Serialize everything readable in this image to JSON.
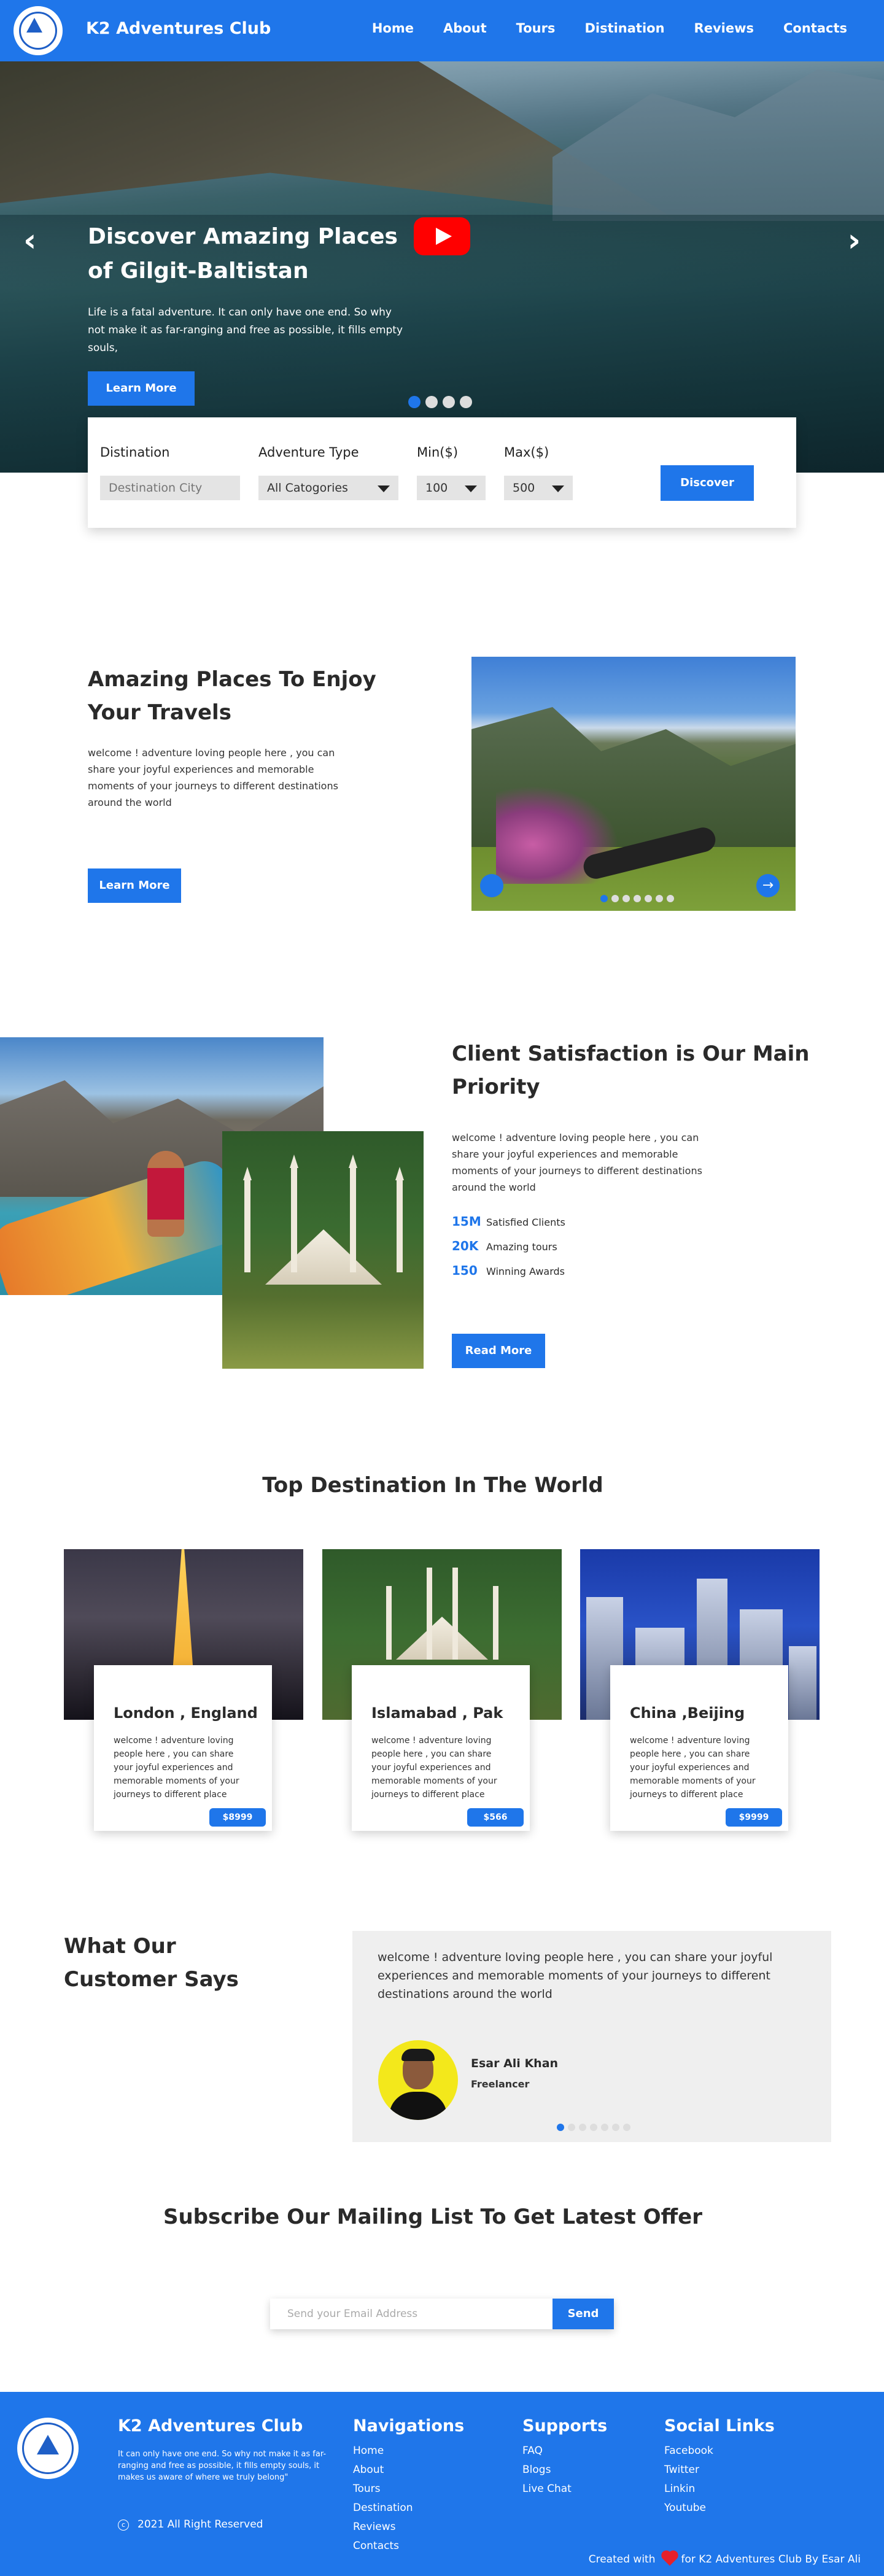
{
  "nav": {
    "brand": "K2 Adventures Club",
    "links": [
      "Home",
      "About",
      "Tours",
      "Distination",
      "Reviews",
      "Contacts"
    ]
  },
  "hero": {
    "title": "Discover Amazing Places of Gilgit-Baltistan",
    "text": "Life is a fatal adventure. It can only have one end. So why not make it as far-ranging and free as possible, it fills empty souls,",
    "button": "Learn More",
    "prev_icon": "chevron-left-icon",
    "next_icon": "chevron-right-icon",
    "slide_count": 4,
    "active_slide": 1
  },
  "search": {
    "destination_label": "Distination",
    "destination_placeholder": "Destination City",
    "type_label": "Adventure Type",
    "type_value": "All Catogories",
    "min_label": "Min($)",
    "min_value": "100",
    "max_label": "Max($)",
    "max_value": "500",
    "button": "Discover"
  },
  "about": {
    "title": "Amazing Places To Enjoy Your Travels",
    "text": "welcome ! adventure loving people here , you can share your joyful experiences and memorable moments of your journeys to different destinations around the world",
    "button": "Learn More",
    "slide_count": 7,
    "active_slide": 1
  },
  "satisfaction": {
    "title": "Client Satisfaction is Our Main Priority",
    "text": "welcome ! adventure loving people here , you can share your joyful experiences and memorable moments of your journeys to different destinations around the world",
    "stats": [
      {
        "value": "15M",
        "label": "Satisfied Clients"
      },
      {
        "value": "20K",
        "label": "Amazing tours"
      },
      {
        "value": "150",
        "label": "Winning Awards"
      }
    ],
    "button": "Read More"
  },
  "destinations": {
    "title": "Top Destination In The World",
    "cards": [
      {
        "name": "London , England",
        "text": "welcome ! adventure loving people here , you can share your joyful experiences and memorable moments of your journeys to different place",
        "price": "$8999"
      },
      {
        "name": "Islamabad , Pak",
        "text": "welcome ! adventure loving people here , you can share your joyful experiences and memorable moments of your journeys to different place",
        "price": "$566"
      },
      {
        "name": "China ,Beijing",
        "text": "welcome ! adventure loving people here , you can share your joyful experiences and memorable moments of your journeys to different place",
        "price": "$9999"
      }
    ]
  },
  "testimonial": {
    "title": "What Our Customer Says",
    "quote": "welcome ! adventure loving people here , you can share your joyful experiences and memorable moments of your journeys to different destinations around the world",
    "name": "Esar Ali Khan",
    "role": "Freelancer",
    "slide_count": 7,
    "active_slide": 1
  },
  "subscribe": {
    "title": "Subscribe Our Mailing List To Get Latest Offer",
    "placeholder": "Send your Email Address",
    "button": "Send"
  },
  "footer": {
    "brand": "K2 Adventures Club",
    "description": "It can only have one end. So why not make it as far-ranging and free as possible, it fills empty souls, it makes us aware of where we truly belong\"",
    "copyright": "2021 All Right Reserved",
    "nav_title": "Navigations",
    "nav_links": [
      "Home",
      "About",
      "Tours",
      "Destination",
      "Reviews",
      "Contacts"
    ],
    "support_title": "Supports",
    "support_links": [
      "FAQ",
      "Blogs",
      "Live Chat"
    ],
    "social_title": "Social Links",
    "social_links": [
      "Facebook",
      "Twitter",
      "Linkin",
      "Youtube"
    ],
    "credit_prefix": "Created with",
    "credit_suffix": "for K2 Adventures Club By Esar Ali"
  },
  "colors": {
    "primary": "#1f76ea",
    "youtube": "#ff0000",
    "heart": "#e5202b",
    "avatar_bg": "#f3e81b"
  }
}
